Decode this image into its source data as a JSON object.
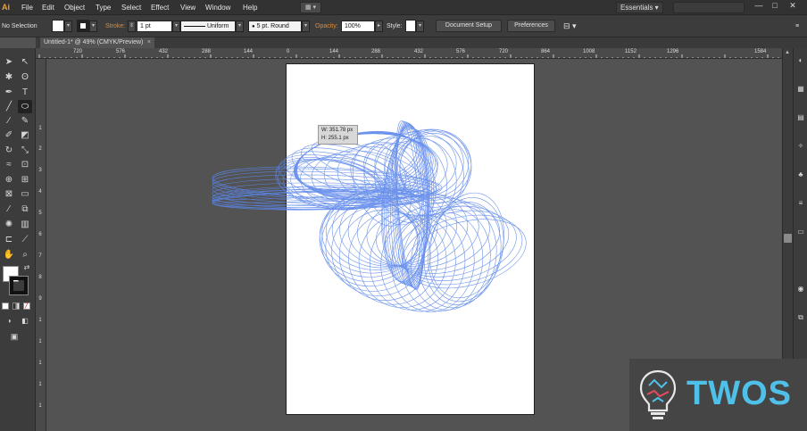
{
  "menubar": {
    "logo": "Ai",
    "items": [
      "File",
      "Edit",
      "Object",
      "Type",
      "Select",
      "Effect",
      "View",
      "Window",
      "Help"
    ],
    "bridge_label": "▦ ▾",
    "workspace": "Essentials ▾",
    "search_placeholder": "",
    "window_controls": [
      "—",
      "□",
      "✕"
    ]
  },
  "controlbar": {
    "selection_label": "No Selection",
    "stroke_label": "Stroke:",
    "stroke_weight": "1 pt",
    "profile_label": "Uniform",
    "brush_label": "5 pt. Round",
    "opacity_label": "Opacity:",
    "opacity_value": "100%",
    "style_label": "Style:",
    "document_setup": "Document Setup",
    "preferences": "Preferences"
  },
  "document_tab": {
    "title": "Untitled-1* @ 49% (CMYK/Preview)",
    "close": "×"
  },
  "ruler_top": [
    "720",
    "576",
    "432",
    "288",
    "144",
    "0",
    "144",
    "288",
    "432",
    "576",
    "720",
    "864",
    "1008",
    "1152",
    "1296",
    "1584"
  ],
  "ruler_left": [
    "1",
    "2",
    "3",
    "4",
    "5",
    "6",
    "7",
    "8",
    "9",
    "1",
    "1",
    "1",
    "1",
    "1"
  ],
  "measure_tooltip": {
    "width": "W: 351.78 px",
    "height": "H: 255.1 px"
  },
  "watermark": {
    "text": "TWOS"
  },
  "colors": {
    "ui_dark": "#3c3c3c",
    "canvas": "#535353",
    "stroke_blue": "#5b86ea",
    "accent_orange": "#e58a2c",
    "watermark_cyan": "#4fc1e9"
  }
}
